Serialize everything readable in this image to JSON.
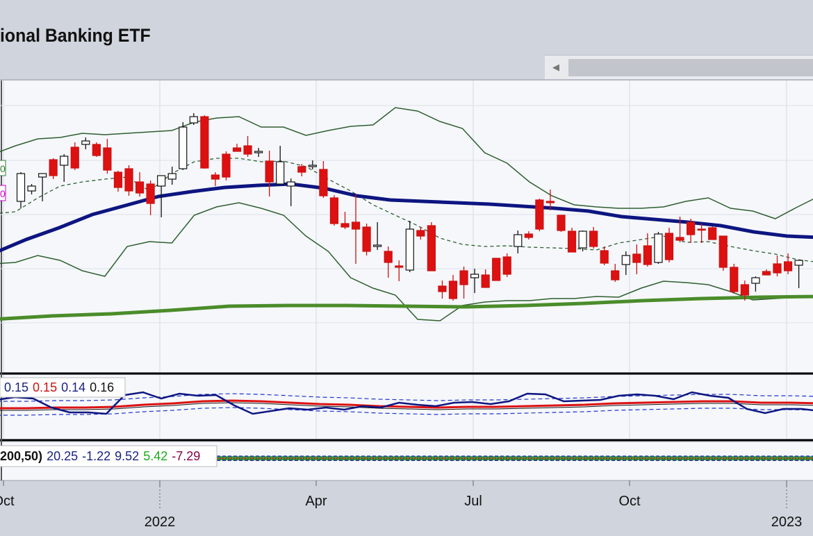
{
  "title": "ional Banking ETF",
  "chart_data": {
    "type": "candlestick",
    "panels": [
      "price",
      "indicator",
      "oscillator"
    ],
    "x_ticks": [
      {
        "label": "Oct",
        "year_label": ""
      },
      {
        "label": "",
        "year_label": "2022"
      },
      {
        "label": "Apr",
        "year_label": ""
      },
      {
        "label": "Jul",
        "year_label": ""
      },
      {
        "label": "Oct",
        "year_label": ""
      },
      {
        "label": "",
        "year_label": "2023"
      }
    ],
    "price_panel": {
      "candles": [
        [
          290,
          250,
          300,
          248
        ],
        [
          275,
          268,
          280,
          265
        ],
        [
          255,
          250,
          290,
          250
        ],
        [
          230,
          253,
          258,
          228
        ],
        [
          238,
          225,
          262,
          222
        ],
        [
          212,
          242,
          245,
          205
        ],
        [
          208,
          203,
          215,
          198
        ],
        [
          208,
          224,
          226,
          205
        ],
        [
          213,
          245,
          250,
          200
        ],
        [
          248,
          270,
          276,
          246
        ],
        [
          243,
          275,
          282,
          238
        ],
        [
          262,
          278,
          283,
          248
        ],
        [
          265,
          293,
          310,
          260
        ],
        [
          268,
          253,
          313,
          262
        ],
        [
          258,
          250,
          266,
          240
        ],
        [
          243,
          183,
          245,
          176
        ],
        [
          177,
          168,
          180,
          163
        ],
        [
          168,
          242,
          243,
          166
        ],
        [
          252,
          258,
          268,
          248
        ],
        [
          222,
          255,
          260,
          218
        ],
        [
          213,
          218,
          218,
          207
        ],
        [
          210,
          222,
          226,
          196
        ],
        [
          220,
          218,
          226,
          213
        ],
        [
          232,
          262,
          283,
          217
        ],
        [
          265,
          233,
          262,
          210
        ],
        [
          268,
          262,
          297,
          257
        ],
        [
          240,
          248,
          254,
          236
        ],
        [
          240,
          238,
          244,
          231
        ],
        [
          244,
          282,
          285,
          232
        ],
        [
          285,
          322,
          325,
          281
        ],
        [
          322,
          327,
          330,
          305
        ],
        [
          320,
          330,
          380,
          280
        ],
        [
          327,
          362,
          368,
          322
        ],
        [
          355,
          353,
          320,
          360
        ],
        [
          362,
          378,
          400,
          355
        ],
        [
          383,
          385,
          405,
          375
        ],
        [
          389,
          330,
          392,
          318
        ],
        [
          332,
          340,
          345,
          327
        ],
        [
          325,
          390,
          390,
          320
        ],
        [
          412,
          420,
          430,
          404
        ],
        [
          405,
          430,
          433,
          396
        ],
        [
          390,
          410,
          430,
          384
        ],
        [
          400,
          395,
          422,
          387
        ],
        [
          396,
          414,
          400,
          388
        ],
        [
          372,
          404,
          403,
          398
        ],
        [
          370,
          395,
          399,
          365
        ],
        [
          355,
          338,
          365,
          332
        ],
        [
          337,
          342,
          345,
          333
        ],
        [
          288,
          330,
          333,
          286
        ],
        [
          290,
          292,
          303,
          273
        ],
        [
          310,
          332,
          334,
          310
        ],
        [
          333,
          363,
          360,
          328
        ],
        [
          357,
          333,
          362,
          332
        ],
        [
          333,
          355,
          358,
          327
        ],
        [
          361,
          379,
          382,
          355
        ],
        [
          390,
          403,
          406,
          380
        ],
        [
          381,
          368,
          396,
          362
        ],
        [
          366,
          378,
          395,
          352
        ],
        [
          354,
          381,
          384,
          336
        ],
        [
          378,
          337,
          380,
          334
        ],
        [
          336,
          374,
          378,
          328
        ],
        [
          342,
          346,
          349,
          312
        ],
        [
          320,
          338,
          350,
          315
        ],
        [
          330,
          330,
          322,
          350
        ],
        [
          328,
          345,
          343,
          326
        ],
        [
          340,
          385,
          390,
          340
        ],
        [
          385,
          420,
          423,
          380
        ],
        [
          410,
          425,
          433,
          404
        ],
        [
          408,
          400,
          420,
          398
        ],
        [
          391,
          396,
          395,
          388
        ],
        [
          380,
          393,
          398,
          368
        ],
        [
          377,
          390,
          395,
          365
        ],
        [
          382,
          375,
          415,
          377
        ]
      ],
      "band_upper": [
        222,
        210,
        200,
        198,
        192,
        194,
        192,
        190,
        188,
        176,
        170,
        168,
        183,
        183,
        195,
        188,
        182,
        180,
        155,
        160,
        175,
        185,
        220,
        235,
        262,
        282,
        295,
        298,
        300,
        300,
        298,
        290,
        285,
        300,
        304,
        315,
        298,
        282
      ],
      "band_middle": [
        308,
        305,
        285,
        268,
        262,
        258,
        255,
        275,
        250,
        233,
        228,
        228,
        233,
        232,
        240,
        258,
        275,
        295,
        310,
        325,
        343,
        352,
        355,
        354,
        356,
        357,
        358,
        360,
        350,
        345,
        340,
        349,
        348,
        355,
        361,
        366,
        374,
        378
      ],
      "band_lower": [
        380,
        378,
        368,
        375,
        390,
        398,
        355,
        348,
        350,
        310,
        298,
        292,
        300,
        310,
        340,
        362,
        400,
        415,
        425,
        460,
        462,
        440,
        435,
        433,
        433,
        430,
        430,
        427,
        428,
        415,
        405,
        407,
        410,
        420,
        432,
        430,
        428,
        429
      ],
      "ma50": [
        365,
        345,
        328,
        309,
        296,
        283,
        276,
        270,
        267,
        265,
        271,
        282,
        288,
        290,
        292,
        294,
        297,
        300,
        304,
        312,
        316,
        320,
        325,
        334,
        340,
        342
      ],
      "ma200": [
        460,
        455,
        452,
        447,
        441,
        440,
        440,
        441,
        442,
        440,
        437,
        433,
        430,
        428,
        427
      ]
    },
    "indicator_panel": {
      "legend": [
        "0.15",
        "0.15",
        "0.14",
        "0.16"
      ],
      "legend_colors": [
        "#1a237e",
        "#cc1111",
        "#1a237e",
        "#111111"
      ],
      "main": [
        576,
        572,
        574,
        587,
        594,
        594,
        596,
        569,
        565,
        574,
        567,
        570,
        569,
        584,
        596,
        592,
        588,
        590,
        587,
        590,
        585,
        587,
        580,
        583,
        585,
        580,
        579,
        582,
        578,
        567,
        568,
        578,
        577,
        576,
        570,
        568,
        570,
        575,
        565,
        570,
        573,
        589,
        595,
        589,
        589,
        592
      ],
      "signal": [
        588,
        588,
        587,
        587,
        586,
        583,
        581,
        578,
        577,
        578,
        580,
        582,
        583,
        585,
        586,
        587,
        586,
        586,
        585,
        584,
        583,
        581,
        580,
        579,
        578,
        578,
        580,
        580,
        581
      ]
    },
    "oscillator_panel": {
      "label": "200,50)",
      "legend": [
        "20.25",
        "-1.22",
        "9.52",
        "5.42",
        "-7.29"
      ],
      "legend_colors": [
        "#1a237e",
        "#1a237e",
        "#1a237e",
        "#1aaa1a",
        "#880044"
      ]
    }
  }
}
